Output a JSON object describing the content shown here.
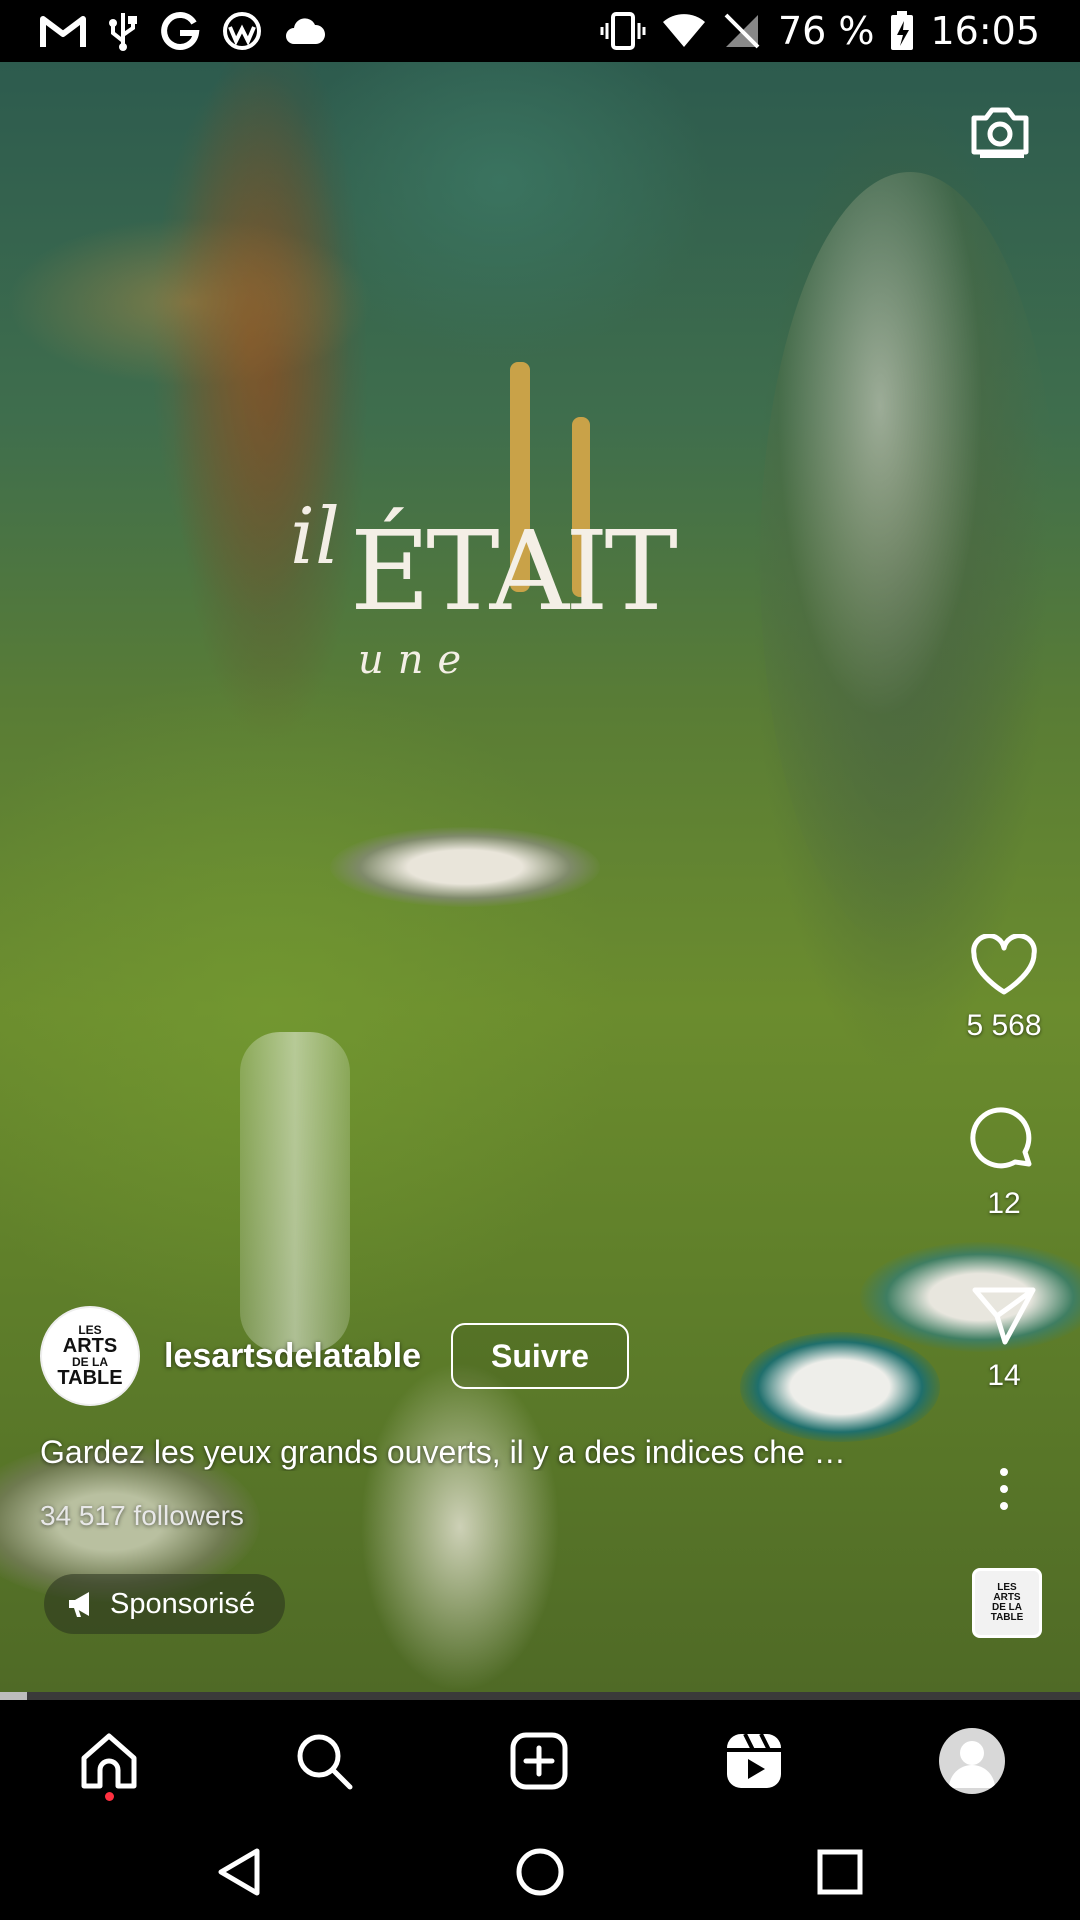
{
  "status_bar": {
    "battery": "76 %",
    "time": "16:05",
    "left_icons": [
      "gmail-icon",
      "usb-icon",
      "google-icon",
      "app-icon",
      "cloud-icon"
    ],
    "right_icons": [
      "vibrate-icon",
      "wifi-icon",
      "no-signal-icon",
      "battery-charging-icon"
    ]
  },
  "video": {
    "overlay_title_line1": "il",
    "overlay_title_line2": "ÉTAIT",
    "overlay_title_line3": "une",
    "progress_fraction": 0.025
  },
  "post": {
    "avatar_text": [
      "LES",
      "ARTS",
      "DE LA",
      "TABLE"
    ],
    "username": "lesartsdelatable",
    "follow_label": "Suivre",
    "caption": "Gardez les yeux grands ouverts, il y a des indices che …",
    "followers": "34 517 followers",
    "sponsored_label": "Sponsorisé"
  },
  "actions": {
    "likes": "5 568",
    "comments": "12",
    "shares": "14"
  },
  "audio_thumb_text": [
    "LES",
    "ARTS",
    "DE LA",
    "TABLE"
  ],
  "bottom_nav": [
    "home-icon",
    "search-icon",
    "create-icon",
    "reels-icon",
    "profile-avatar"
  ],
  "colors": {
    "notification_dot": "#ff3040",
    "background": "#000000"
  }
}
